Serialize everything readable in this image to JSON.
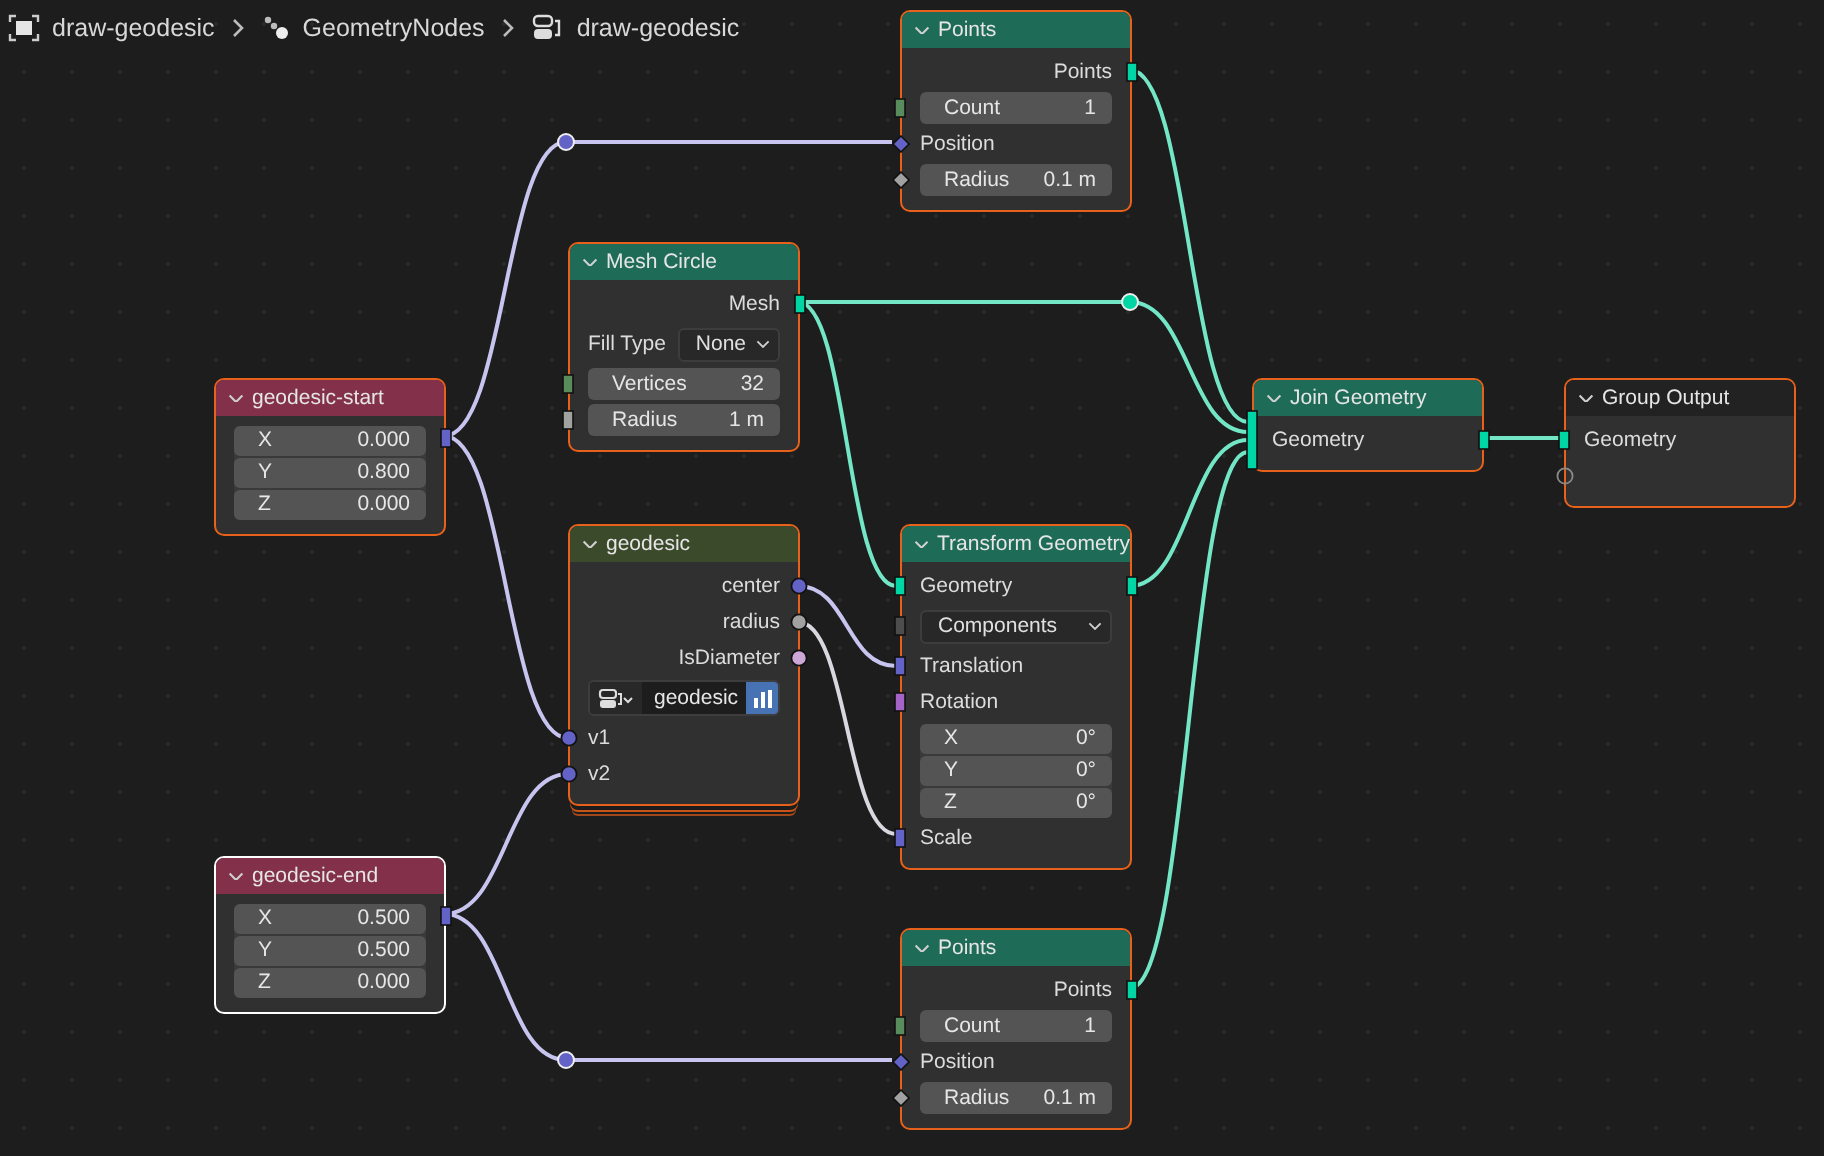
{
  "breadcrumb": [
    {
      "kind": "tree",
      "label": "draw-geodesic"
    },
    {
      "kind": "modifier",
      "label": "GeometryNodes"
    },
    {
      "kind": "group",
      "label": "draw-geodesic"
    }
  ],
  "nodes": [
    {
      "kind": "geometry",
      "title": "Points",
      "selected": true,
      "active": false,
      "rows": [
        {
          "kind": "output",
          "label": "Points",
          "out": {
            "kind": "geometry"
          }
        },
        {
          "kind": "field",
          "label": "Count",
          "value": "1",
          "in": {
            "kind": "int"
          }
        },
        {
          "kind": "input",
          "label": "Position",
          "in": {
            "kind": "vectordiamond"
          }
        },
        {
          "kind": "field",
          "label": "Radius",
          "value": "0.1 m",
          "in": {
            "kind": "floatdiamond"
          }
        }
      ]
    },
    {
      "kind": "geometry",
      "title": "Mesh Circle",
      "selected": true,
      "active": false,
      "rows": [
        {
          "kind": "output",
          "label": "Mesh",
          "out": {
            "kind": "geometry"
          }
        },
        {
          "kind": "dropdown",
          "label": "Fill Type",
          "value": "None"
        },
        {
          "kind": "field",
          "label": "Vertices",
          "value": "32",
          "in": {
            "kind": "int"
          }
        },
        {
          "kind": "field",
          "label": "Radius",
          "value": "1 m",
          "in": {
            "kind": "float"
          }
        }
      ]
    },
    {
      "kind": "input",
      "title": "geodesic-start",
      "selected": true,
      "active": false,
      "rows": [
        {
          "kind": "vector",
          "fields": [
            {
              "label": "X",
              "value": "0.000"
            },
            {
              "label": "Y",
              "value": "0.800"
            },
            {
              "label": "Z",
              "value": "0.000"
            }
          ],
          "out": {
            "kind": "vector"
          }
        }
      ]
    },
    {
      "kind": "group",
      "title": "geodesic",
      "selected": true,
      "active": false,
      "rows": [
        {
          "kind": "output",
          "label": "center",
          "out": {
            "kind": "vectorcircle"
          }
        },
        {
          "kind": "output",
          "label": "radius",
          "out": {
            "kind": "floatcircle"
          }
        },
        {
          "kind": "output",
          "label": "IsDiameter",
          "out": {
            "kind": "booleancircle"
          }
        },
        {
          "kind": "datablock",
          "value": "geodesic"
        },
        {
          "kind": "input",
          "label": "v1",
          "in": {
            "kind": "vectorcircle"
          }
        },
        {
          "kind": "input",
          "label": "v2",
          "in": {
            "kind": "vectorcircle"
          }
        }
      ]
    },
    {
      "kind": "geometry",
      "title": "Transform Geometry",
      "selected": true,
      "active": false,
      "rows": [
        {
          "kind": "input",
          "label": "Geometry",
          "in": {
            "kind": "geometry"
          },
          "out": {
            "kind": "geometry"
          }
        },
        {
          "kind": "dropdown",
          "value": "Components",
          "in": {
            "kind": "menu"
          }
        },
        {
          "kind": "input",
          "label": "Translation",
          "in": {
            "kind": "vector"
          }
        },
        {
          "kind": "input",
          "label": "Rotation",
          "in": {
            "kind": "rotation"
          }
        },
        {
          "kind": "vector",
          "fields": [
            {
              "label": "X",
              "value": "0°"
            },
            {
              "label": "Y",
              "value": "0°"
            },
            {
              "label": "Z",
              "value": "0°"
            }
          ]
        },
        {
          "kind": "input",
          "label": "Scale",
          "in": {
            "kind": "vector"
          }
        }
      ]
    },
    {
      "kind": "geometry",
      "title": "Join Geometry",
      "selected": true,
      "active": false,
      "rows": [
        {
          "kind": "input",
          "label": "Geometry",
          "in": {
            "kind": "multigeometry"
          },
          "out": {
            "kind": "geometry"
          }
        }
      ]
    },
    {
      "kind": "output",
      "title": "Group Output",
      "selected": true,
      "active": false,
      "rows": [
        {
          "kind": "input",
          "label": "Geometry",
          "in": {
            "kind": "geometry"
          }
        },
        {
          "kind": "empty",
          "in": {
            "kind": "virtual"
          }
        }
      ]
    },
    {
      "kind": "input",
      "title": "geodesic-end",
      "selected": true,
      "active": true,
      "rows": [
        {
          "kind": "vector",
          "fields": [
            {
              "label": "X",
              "value": "0.500"
            },
            {
              "label": "Y",
              "value": "0.500"
            },
            {
              "label": "Z",
              "value": "0.000"
            }
          ],
          "out": {
            "kind": "vector"
          }
        }
      ]
    },
    {
      "kind": "geometry",
      "title": "Points",
      "selected": true,
      "active": false,
      "rows": [
        {
          "kind": "output",
          "label": "Points",
          "out": {
            "kind": "geometry"
          }
        },
        {
          "kind": "field",
          "label": "Count",
          "value": "1",
          "in": {
            "kind": "int"
          }
        },
        {
          "kind": "input",
          "label": "Position",
          "in": {
            "kind": "vectordiamond"
          }
        },
        {
          "kind": "field",
          "label": "Radius",
          "value": "0.1 m",
          "in": {
            "kind": "floatdiamond"
          }
        }
      ]
    }
  ]
}
